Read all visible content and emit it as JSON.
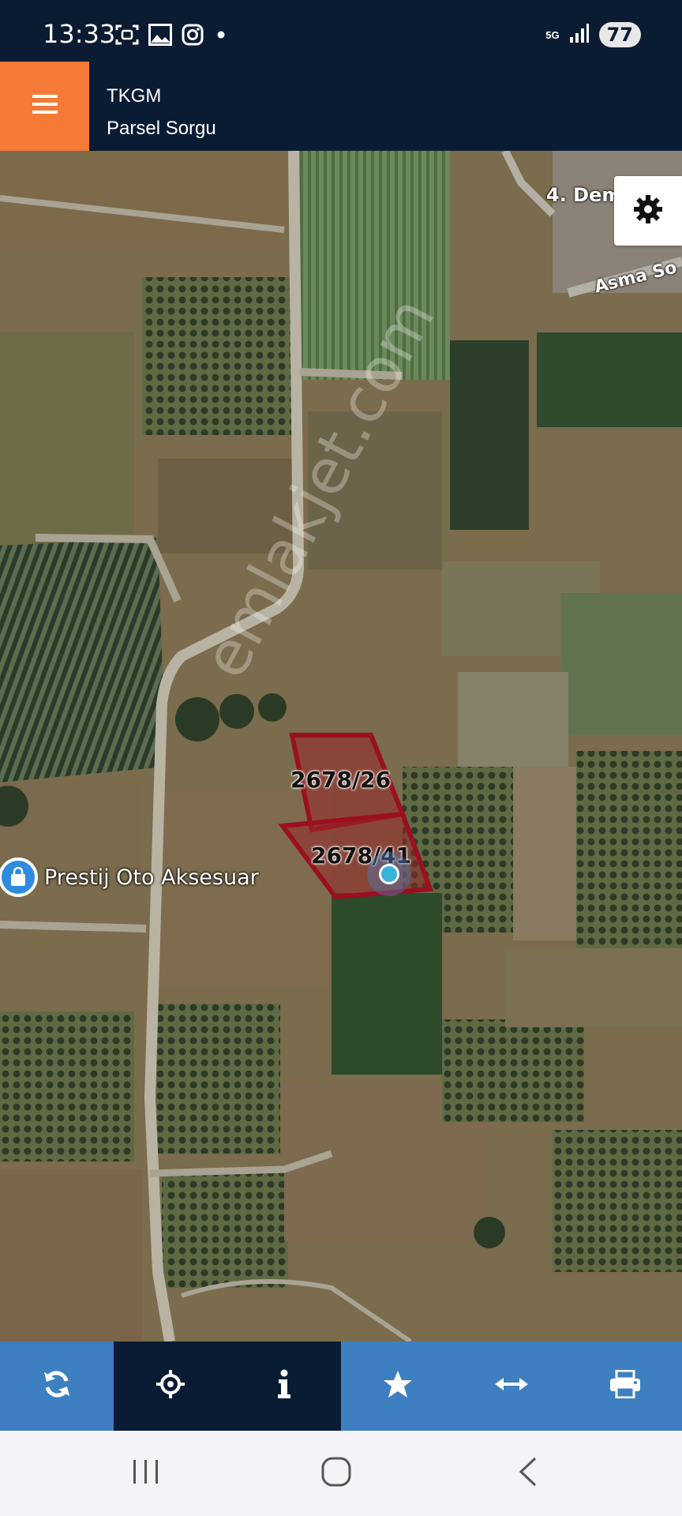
{
  "status_bar": {
    "time": "13:33",
    "network": "5G",
    "battery": "77",
    "icons": [
      "screenshot-icon",
      "gallery-icon",
      "instagram-icon",
      "notification-dot-icon",
      "signal-icon"
    ]
  },
  "header": {
    "title": "TKGM",
    "subtitle": "Parsel Sorgu",
    "menu_icon": "hamburger-icon",
    "accent_color": "#f47a36",
    "background_color": "#0a1c33"
  },
  "map": {
    "street_labels": [
      "4. Dem",
      "Asma So"
    ],
    "parcels": [
      {
        "label": "2678/26"
      },
      {
        "label": "2678/41"
      }
    ],
    "parcel_outline_color": "#9a1020",
    "poi": {
      "name": "Prestij Oto Aksesuar",
      "icon": "shopping-bag-icon"
    },
    "watermark": "emlakjet.com",
    "settings_icon": "gear-icon"
  },
  "toolbar": {
    "items": [
      {
        "name": "refresh",
        "icon": "refresh-icon",
        "active": false
      },
      {
        "name": "locate",
        "icon": "crosshair-icon",
        "active": true
      },
      {
        "name": "info",
        "icon": "info-icon",
        "active": true
      },
      {
        "name": "favorite",
        "icon": "star-icon",
        "active": false
      },
      {
        "name": "measure",
        "icon": "arrows-horizontal-icon",
        "active": false
      },
      {
        "name": "print",
        "icon": "print-icon",
        "active": false
      }
    ],
    "color": "#3d7fc0",
    "active_color": "#0a1c33"
  },
  "nav_bar": {
    "buttons": [
      "recent-apps-icon",
      "home-icon",
      "back-icon"
    ]
  }
}
